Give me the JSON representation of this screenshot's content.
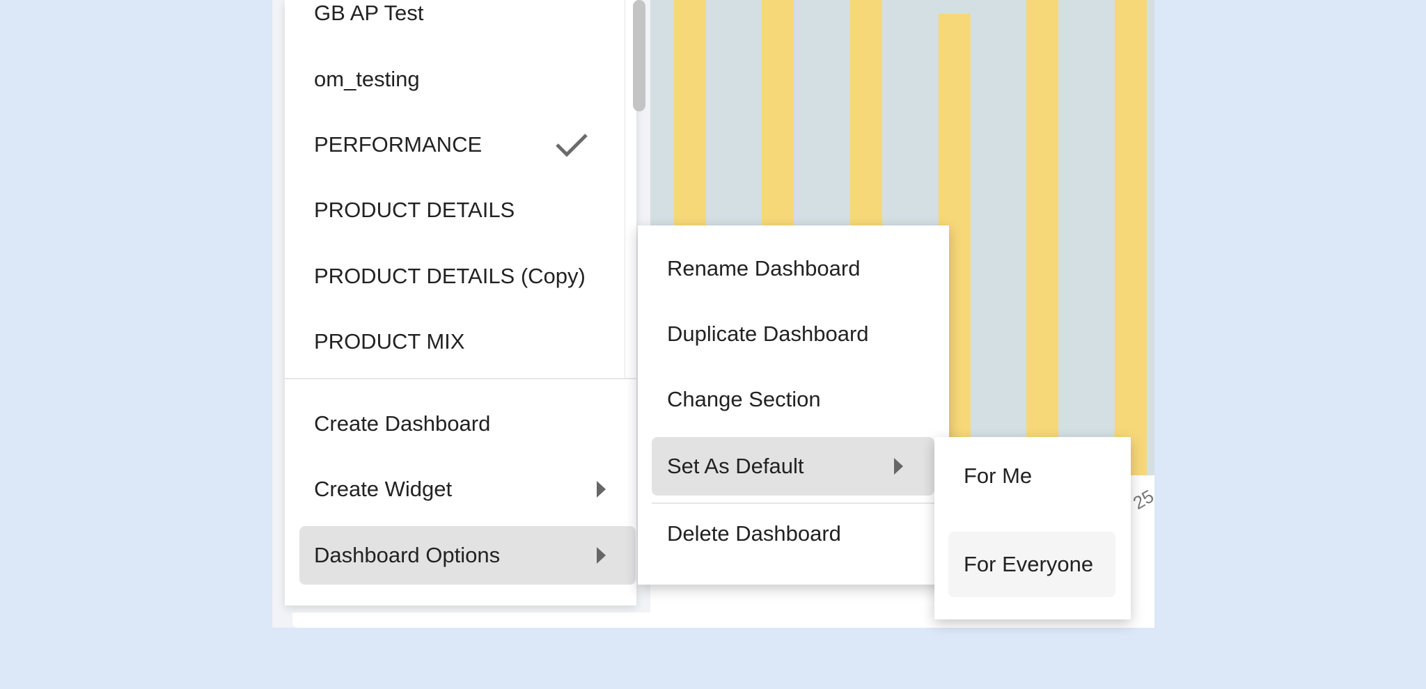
{
  "dashboards": {
    "items": [
      {
        "label": "GB AP Test",
        "selected": false
      },
      {
        "label": "om_testing",
        "selected": false
      },
      {
        "label": "PERFORMANCE",
        "selected": true
      },
      {
        "label": "PRODUCT DETAILS",
        "selected": false
      },
      {
        "label": "PRODUCT DETAILS (Copy)",
        "selected": false
      },
      {
        "label": "PRODUCT MIX",
        "selected": false
      }
    ]
  },
  "actions": {
    "create_dashboard": "Create Dashboard",
    "create_widget": "Create Widget",
    "dashboard_options": "Dashboard Options"
  },
  "options_menu": {
    "rename": "Rename Dashboard",
    "duplicate": "Duplicate Dashboard",
    "change_section": "Change Section",
    "set_default": "Set As Default",
    "delete": "Delete Dashboard"
  },
  "default_menu": {
    "for_me": "For Me",
    "for_everyone": "For Everyone"
  },
  "chart": {
    "tick_label": "25"
  },
  "colors": {
    "accent_bar": "#f7d878",
    "chart_bg": "#d3dfe2",
    "page_bg": "#dce7f7"
  }
}
